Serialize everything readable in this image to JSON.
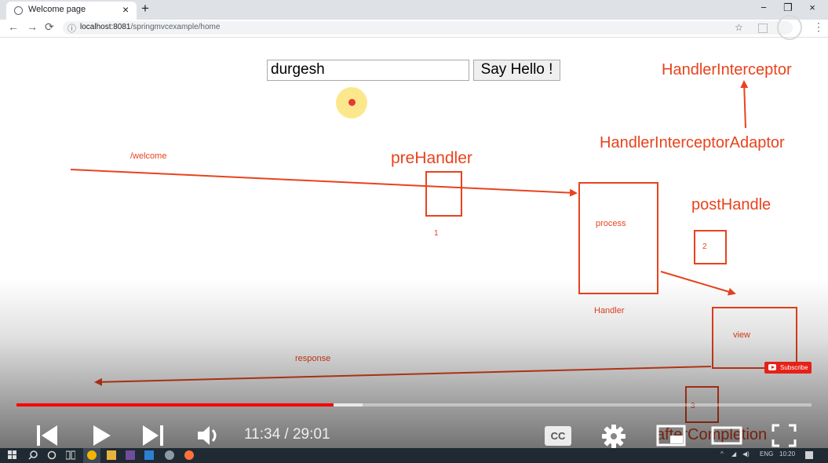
{
  "browser": {
    "tab_title": "Welcome page",
    "tab_close": "×",
    "new_tab": "+",
    "url_host": "localhost:8081",
    "url_path": "/springmvcexample/home",
    "window_controls": {
      "minimize": "−",
      "restore": "❐",
      "close": "×"
    },
    "nav": {
      "back": "←",
      "forward": "→",
      "reload": "⟳",
      "info": "ⓘ",
      "bookmark": "☆",
      "menu": "⋮"
    }
  },
  "page": {
    "input_value": "durgesh",
    "button_label": "Say Hello !"
  },
  "diagram": {
    "handler_interceptor": "HandlerInterceptor",
    "handler_interceptor_adaptor": "HandlerInterceptorAdaptor",
    "pre_handler": "preHandler",
    "post_handle": "postHandle",
    "welcome_path": "/welcome",
    "step1": "1",
    "step2": "2",
    "step3": "3",
    "process": "process",
    "handler": "Handler",
    "view": "view",
    "response": "response",
    "after_completion": "afterCompletion"
  },
  "video": {
    "current_time": "11:34",
    "separator": " / ",
    "duration": "29:01",
    "progress_fraction": 0.399,
    "buffered_fraction": 0.435,
    "subscribe": "Subscribe",
    "cc": "CC"
  },
  "taskbar": {
    "language": "ENG",
    "clock": "10:20"
  },
  "colors": {
    "accent_red": "#e8431d",
    "progress_red": "#ff0000"
  }
}
